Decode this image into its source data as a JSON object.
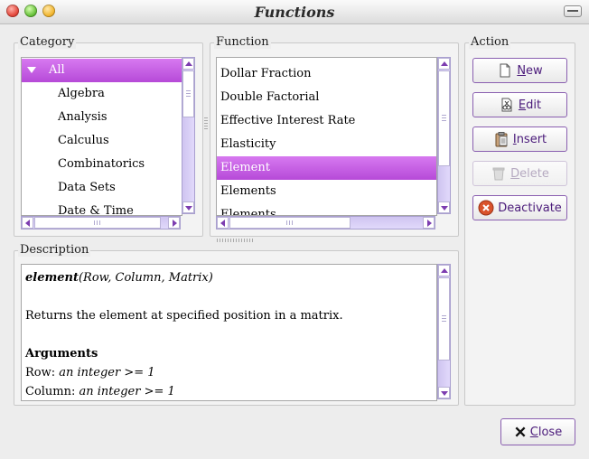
{
  "window": {
    "title": "Functions"
  },
  "groups": {
    "category": "Category",
    "function": "Function",
    "description": "Description",
    "action": "Action"
  },
  "categories": {
    "all_label": "All",
    "items": [
      "Algebra",
      "Analysis",
      "Calculus",
      "Combinatorics",
      "Data Sets",
      "Date & Time"
    ]
  },
  "functions": {
    "items": [
      "Dollar Fraction",
      "Double Factorial",
      "Effective Interest Rate",
      "Elasticity",
      "Element",
      "Elements",
      "Elements"
    ],
    "selected": "Element"
  },
  "description": {
    "signature_name": "element",
    "signature_args": "(Row, Column, Matrix)",
    "summary": "Returns the element at specified position in a matrix.",
    "arguments_heading": "Arguments",
    "args": [
      {
        "name": "Row: ",
        "desc": "an integer >= 1"
      },
      {
        "name": "Column: ",
        "desc": "an integer >= 1"
      }
    ]
  },
  "actions": {
    "new": {
      "first": "N",
      "rest": "ew"
    },
    "edit": {
      "first": "E",
      "rest": "dit"
    },
    "insert": {
      "first": "I",
      "rest": "nsert"
    },
    "delete": {
      "first": "D",
      "rest": "elete"
    },
    "deactivate": {
      "first": "",
      "rest": "Deactivate"
    }
  },
  "close_button": {
    "first": "C",
    "rest": "lose"
  },
  "colors": {
    "selection": "#b64ad8",
    "scrollbar": "#d6cdf5",
    "accent_text": "#4a1a7a"
  }
}
